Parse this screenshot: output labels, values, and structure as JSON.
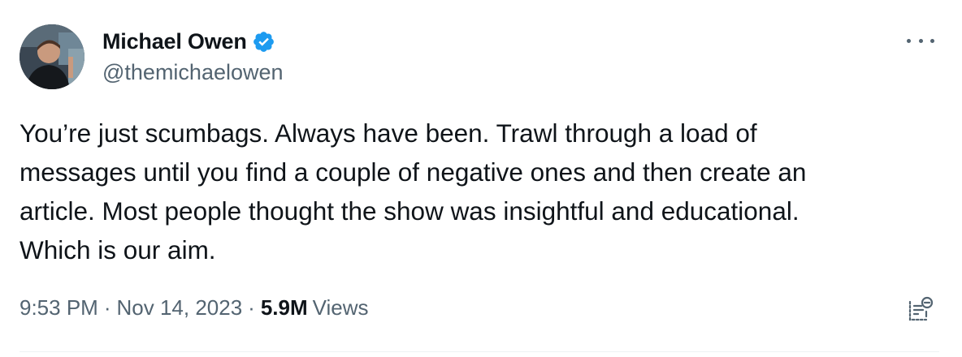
{
  "author": {
    "display_name": "Michael Owen",
    "handle": "@themichaelowen",
    "verified": true
  },
  "tweet": {
    "text": "You’re just scumbags. Always have been. Trawl through a load of\nmessages until you find a couple of negative ones and then create an\narticle. Most people thought the show was insightful and educational.\nWhich is our aim.",
    "time": "9:53 PM",
    "separator": "·",
    "date": "Nov 14, 2023",
    "views_count": "5.9M",
    "views_label": "Views"
  },
  "icons": {
    "verified": "verified-badge-icon",
    "more": "more-options-icon",
    "analytics": "view-analytics-icon"
  },
  "colors": {
    "text_primary": "#0f1419",
    "text_secondary": "#536471",
    "verified_blue": "#1d9bf0",
    "divider": "#eff3f4"
  }
}
